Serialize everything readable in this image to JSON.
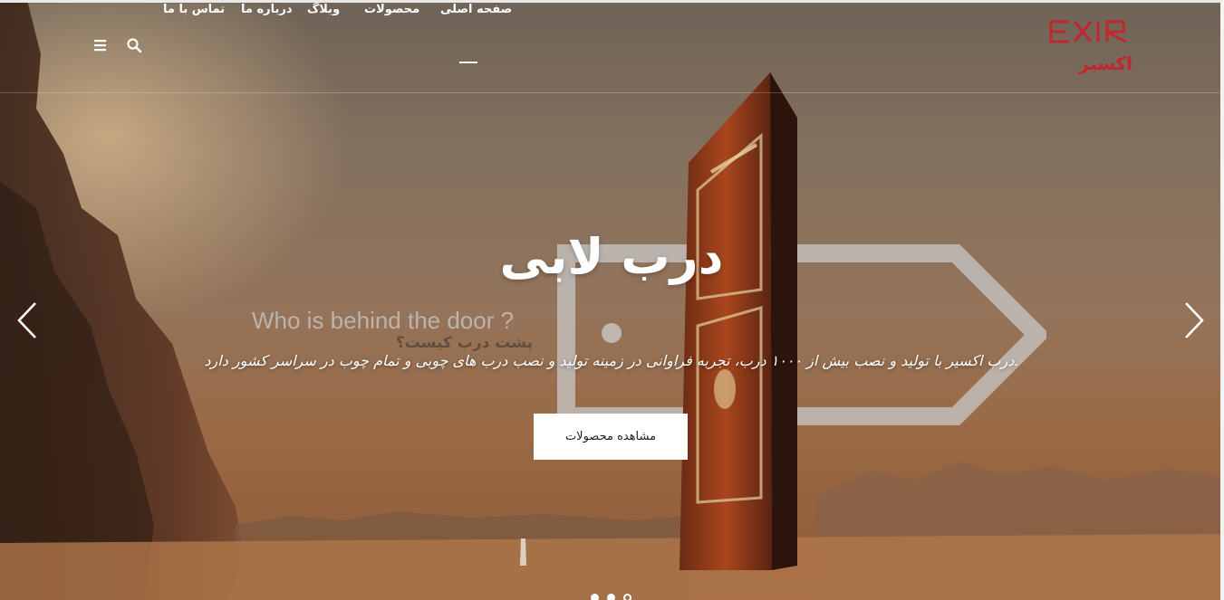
{
  "navbar": {
    "items": [
      {
        "label": "صفحه اصلی",
        "active": true
      },
      {
        "label": "محصولات"
      },
      {
        "label": "وبلاگ"
      },
      {
        "label": "درباره ما"
      },
      {
        "label": "تماس با ما"
      }
    ],
    "icons": [
      "search-icon",
      "menu-icon"
    ]
  },
  "logo": {
    "latin": "EXIR",
    "persian": "اکسیر",
    "color": "#c1272d"
  },
  "slide": {
    "title": "درب لابی",
    "sign_english": "Who is behind the door ?",
    "sign_persian": "پشت درب کیست؟",
    "description": ".درب اکسیر با تولید و نصب بیش از ۱۰۰۰ درب، تجربه فراوانی در زمینه تولید و نصب درب های چوبی و تمام چوب در سراسر کشور دارد",
    "button_label": "مشاهده محصولات"
  },
  "carousel": {
    "slide_count": 3,
    "active_index": 2
  }
}
